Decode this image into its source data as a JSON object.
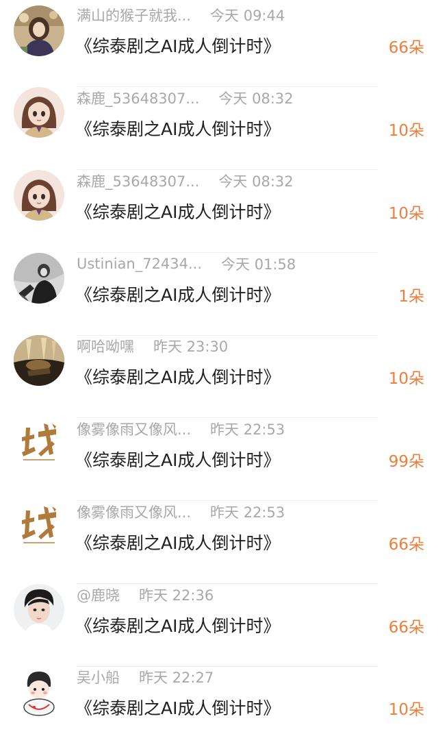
{
  "items": [
    {
      "username": "满山的猴子就我...",
      "time": "今天 09:44",
      "title": "《综泰剧之AI成人倒计时》",
      "count": "66朵",
      "avatar_icon": "avatar-girl-portrait-icon"
    },
    {
      "username": "森鹿_53648307...",
      "time": "今天 08:32",
      "title": "《综泰剧之AI成人倒计时》",
      "count": "10朵",
      "avatar_icon": "avatar-anime-girl-icon"
    },
    {
      "username": "森鹿_53648307...",
      "time": "今天 08:32",
      "title": "《综泰剧之AI成人倒计时》",
      "count": "10朵",
      "avatar_icon": "avatar-anime-girl-icon"
    },
    {
      "username": "Ustinian_72434...",
      "time": "今天 01:58",
      "title": "《综泰剧之AI成人倒计时》",
      "count": "1朵",
      "avatar_icon": "avatar-monochrome-photo-icon"
    },
    {
      "username": "啊哈呦嘿",
      "time": "昨天 23:30",
      "title": "《综泰剧之AI成人倒计时》",
      "count": "10朵",
      "avatar_icon": "avatar-golden-scene-icon"
    },
    {
      "username": "像雾像雨又像风...",
      "time": "昨天 22:53",
      "title": "《综泰剧之AI成人倒计时》",
      "count": "99朵",
      "avatar_icon": "avatar-calligraphy-zhan-icon"
    },
    {
      "username": "像雾像雨又像风...",
      "time": "昨天 22:53",
      "title": "《综泰剧之AI成人倒计时》",
      "count": "66朵",
      "avatar_icon": "avatar-calligraphy-zhan-icon"
    },
    {
      "username": "@鹿晓",
      "time": "昨天 22:36",
      "title": "《综泰剧之AI成人倒计时》",
      "count": "66朵",
      "avatar_icon": "avatar-young-man-photo-icon"
    },
    {
      "username": "吴小船",
      "time": "昨天 22:27",
      "title": "《综泰剧之AI成人倒计时》",
      "count": "10朵",
      "avatar_icon": "avatar-cartoon-character-icon"
    }
  ],
  "colors": {
    "meta_text": "#a8a8a8",
    "title_text": "#202020",
    "count_accent": "#ef7d3a",
    "divider": "#eeeeee"
  }
}
